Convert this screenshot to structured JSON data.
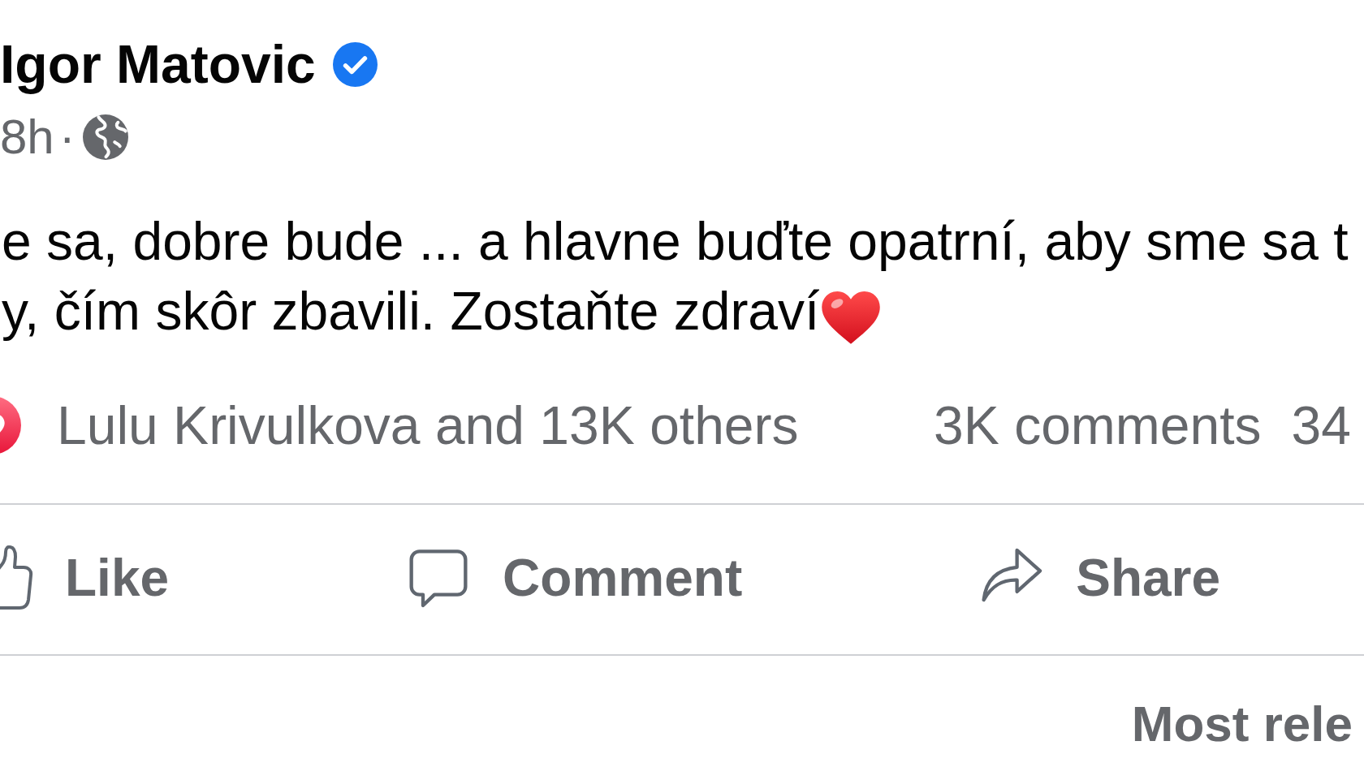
{
  "post": {
    "author": {
      "name": "Igor Matovic",
      "verified": true
    },
    "time": "8h",
    "separator": "·",
    "text_lines": [
      "e sa, dobre bude ... a hlavne buďte opatrní, aby sme sa t",
      "y, čím skôr zbavili. Zostaňte zdraví"
    ]
  },
  "reactions": {
    "summary": "Lulu Krivulkova and 13K others",
    "comments": "3K comments",
    "shares": "34"
  },
  "actions": [
    {
      "kind": "like",
      "label": "Like"
    },
    {
      "kind": "comment",
      "label": "Comment"
    },
    {
      "kind": "share",
      "label": "Share"
    }
  ],
  "comment_sort": "Most rele"
}
